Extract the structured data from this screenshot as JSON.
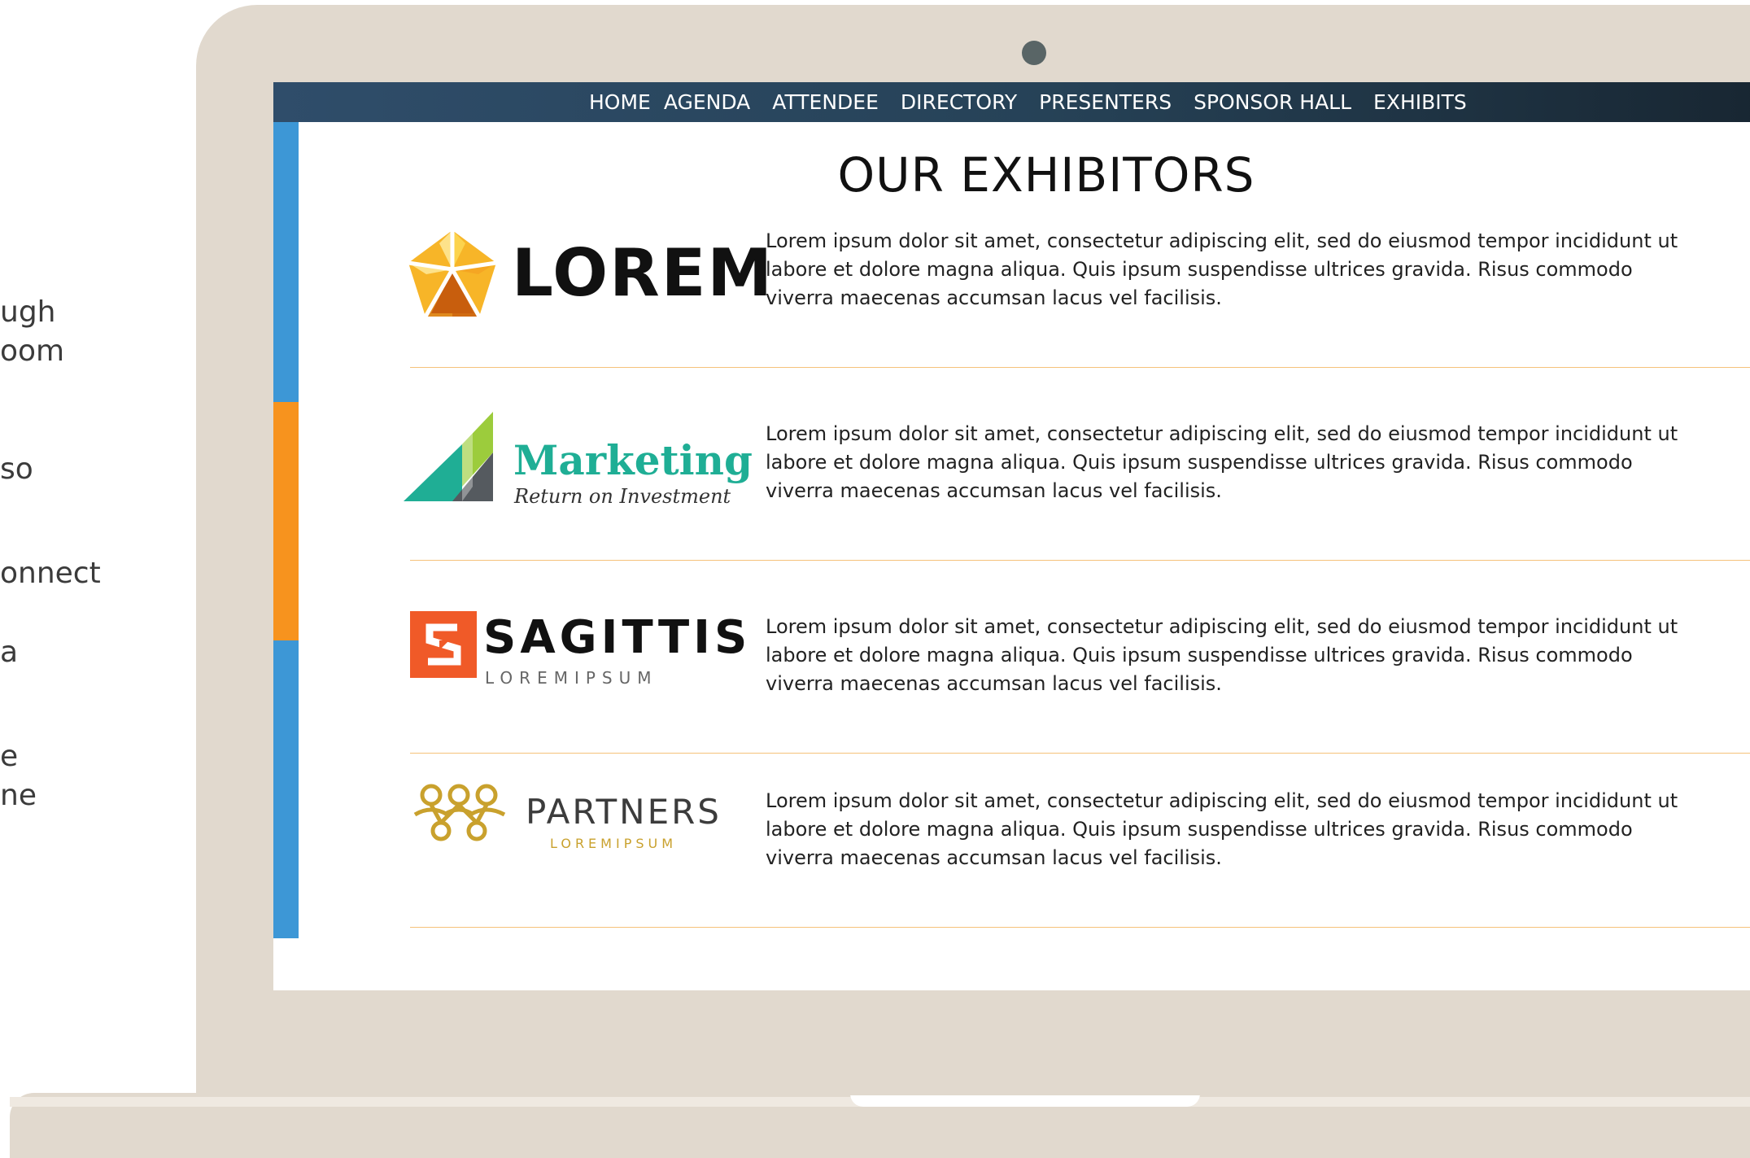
{
  "slide_text": {
    "fragments": [
      "ugh",
      "oom",
      "so",
      "onnect",
      "a",
      "e",
      "ne"
    ]
  },
  "nav": {
    "items": [
      "HOME",
      "AGENDA",
      "ATTENDEE",
      "DIRECTORY",
      "PRESENTERS",
      "SPONSOR HALL",
      "EXHIBITS"
    ]
  },
  "page": {
    "title": "OUR EXHIBITORS"
  },
  "exhibitors": [
    {
      "logo_text": "LOREM",
      "description": "Lorem ipsum dolor sit amet, consectetur adipiscing elit, sed do eiusmod tempor incididunt ut labore et dolore magna aliqua. Quis ipsum suspendisse ultrices gravida. Risus commodo viverra maecenas accumsan lacus vel facilisis."
    },
    {
      "logo_text": "Marketing",
      "logo_subtext": "Return on Investment",
      "description": "Lorem ipsum dolor sit amet, consectetur adipiscing elit, sed do eiusmod tempor incididunt ut labore et dolore magna aliqua. Quis ipsum suspendisse ultrices gravida. Risus commodo viverra maecenas accumsan lacus vel facilisis."
    },
    {
      "logo_text": "SAGITTIS",
      "logo_subtext": "LOREMIPSUM",
      "description": "Lorem ipsum dolor sit amet, consectetur adipiscing elit, sed do eiusmod tempor incididunt ut labore et dolore magna aliqua. Quis ipsum suspendisse ultrices gravida. Risus commodo viverra maecenas accumsan lacus vel facilisis."
    },
    {
      "logo_text": "PARTNERS",
      "logo_subtext": "LOREMIPSUM",
      "description": "Lorem ipsum dolor sit amet, consectetur adipiscing elit, sed do eiusmod tempor incididunt ut labore et dolore magna aliqua. Quis ipsum suspendisse ultrices gravida. Risus commodo viverra maecenas accumsan lacus vel facilisis."
    }
  ],
  "colors": {
    "nav_start": "#2f4d6a",
    "nav_end": "#17242f",
    "accent_blue": "#3d97d6",
    "accent_orange": "#f7931e",
    "divider": "#f5c27a",
    "laptop_frame": "#e1d9ce",
    "marketing_green": "#1fae95",
    "sagittis_orange": "#f05a28",
    "partners_gold": "#c9a12d"
  },
  "icons": [
    "camera-icon",
    "lorem-star-logo-icon",
    "marketing-triangle-logo-icon",
    "sagittis-s-logo-icon",
    "partners-loops-logo-icon"
  ]
}
